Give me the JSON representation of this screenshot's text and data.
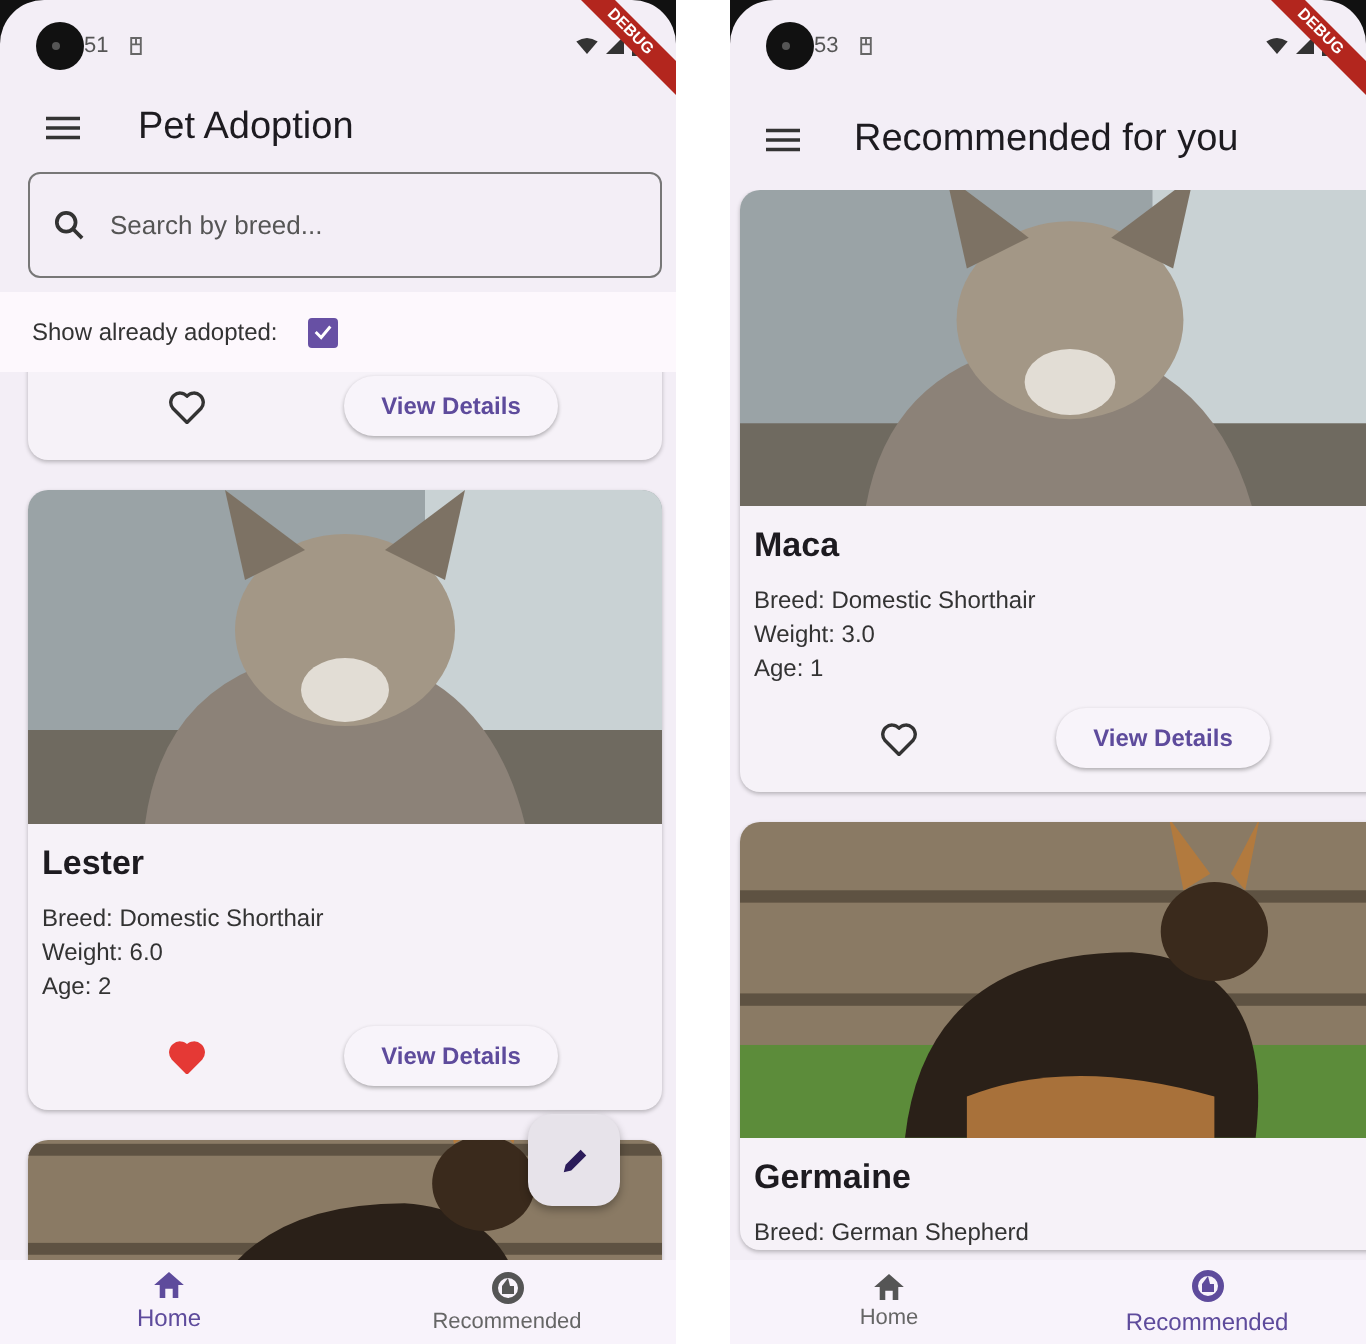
{
  "screens": [
    {
      "status_time": "51",
      "debug_banner": "DEBUG",
      "title": "Pet Adoption",
      "search": {
        "placeholder": "Search by breed..."
      },
      "filter": {
        "label": "Show already adopted:",
        "checked": true
      },
      "cards": [
        {
          "kind": "actions_only",
          "favorite": false,
          "button": "View Details"
        },
        {
          "kind": "full",
          "name": "Lester",
          "details": [
            "Breed: Domestic Shorthair",
            "Weight: 6.0",
            "Age: 2"
          ],
          "favorite": true,
          "button": "View Details"
        },
        {
          "kind": "picture_only"
        }
      ],
      "fab": true,
      "nav": [
        {
          "label": "Home",
          "selected": true
        },
        {
          "label": "Recommended",
          "selected": false
        }
      ]
    },
    {
      "status_time": "53",
      "debug_banner": "DEBUG",
      "title": "Recommended for you",
      "cards": [
        {
          "kind": "full",
          "name": "Maca",
          "details": [
            "Breed: Domestic Shorthair",
            "Weight: 3.0",
            "Age: 1"
          ],
          "favorite": false,
          "button": "View Details"
        },
        {
          "kind": "full",
          "name": "Germaine",
          "details": [
            "Breed: German Shepherd"
          ]
        }
      ],
      "nav": [
        {
          "label": "Home",
          "selected": false
        },
        {
          "label": "Recommended",
          "selected": true
        }
      ]
    }
  ]
}
